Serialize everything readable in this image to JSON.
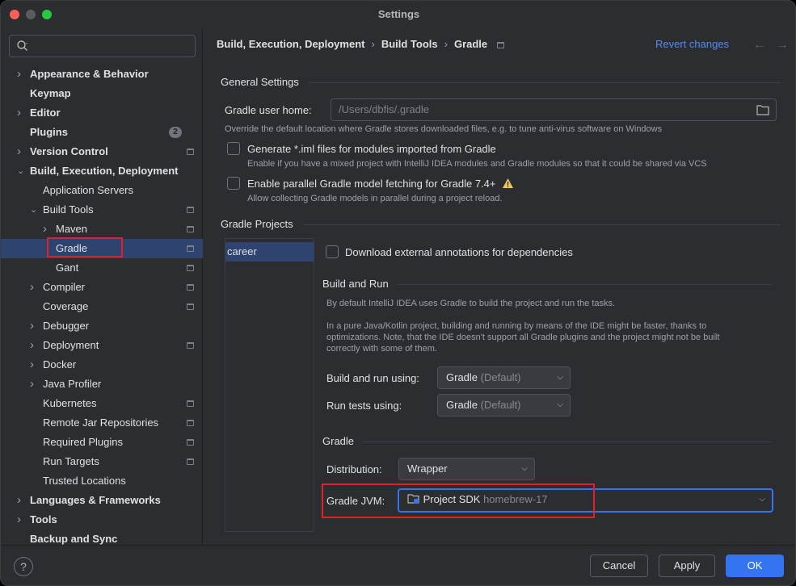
{
  "window": {
    "title": "Settings"
  },
  "search": {
    "placeholder": ""
  },
  "sidebar": {
    "items": [
      {
        "label": "Appearance & Behavior",
        "bold": true,
        "arrow": "right"
      },
      {
        "label": "Keymap",
        "bold": true
      },
      {
        "label": "Editor",
        "bold": true,
        "arrow": "right"
      },
      {
        "label": "Plugins",
        "bold": true,
        "badge": "2"
      },
      {
        "label": "Version Control",
        "bold": true,
        "arrow": "right",
        "project_icon": true
      },
      {
        "label": "Build, Execution, Deployment",
        "bold": true,
        "arrow": "down"
      },
      {
        "label": "Application Servers"
      },
      {
        "label": "Build Tools",
        "arrow": "down",
        "project_icon": true
      },
      {
        "label": "Maven",
        "arrow": "right",
        "project_icon": true
      },
      {
        "label": "Gradle",
        "selected": true,
        "project_icon": true
      },
      {
        "label": "Gant",
        "project_icon": true
      },
      {
        "label": "Compiler",
        "arrow": "right",
        "project_icon": true
      },
      {
        "label": "Coverage",
        "project_icon": true
      },
      {
        "label": "Debugger",
        "arrow": "right"
      },
      {
        "label": "Deployment",
        "arrow": "right",
        "project_icon": true
      },
      {
        "label": "Docker",
        "arrow": "right"
      },
      {
        "label": "Java Profiler",
        "arrow": "right"
      },
      {
        "label": "Kubernetes",
        "project_icon": true
      },
      {
        "label": "Remote Jar Repositories",
        "project_icon": true
      },
      {
        "label": "Required Plugins",
        "project_icon": true
      },
      {
        "label": "Run Targets",
        "project_icon": true
      },
      {
        "label": "Trusted Locations"
      },
      {
        "label": "Languages & Frameworks",
        "bold": true,
        "arrow": "right"
      },
      {
        "label": "Tools",
        "bold": true,
        "arrow": "right"
      },
      {
        "label": "Backup and Sync",
        "bold": true
      }
    ]
  },
  "breadcrumb": {
    "part1": "Build, Execution, Deployment",
    "part2": "Build Tools",
    "part3": "Gradle",
    "sep": "›"
  },
  "header": {
    "revert_label": "Revert changes",
    "back_arrow": "←",
    "forward_arrow": "→"
  },
  "general": {
    "title": "General Settings",
    "user_home_label": "Gradle user home:",
    "user_home_value": "/Users/dbfis/.gradle",
    "user_home_hint": "Override the default location where Gradle stores downloaded files, e.g. to tune anti-virus software on Windows",
    "iml_label": "Generate *.iml files for modules imported from Gradle",
    "iml_hint": "Enable if you have a mixed project with IntelliJ IDEA modules and Gradle modules so that it could be shared via VCS",
    "parallel_label": "Enable parallel Gradle model fetching for Gradle 7.4+",
    "parallel_hint": "Allow collecting Gradle models in parallel during a project reload."
  },
  "projects": {
    "title": "Gradle Projects",
    "list": [
      "career"
    ],
    "annotations_label": "Download external annotations for dependencies"
  },
  "build_run": {
    "title": "Build and Run",
    "desc1": "By default IntelliJ IDEA uses Gradle to build the project and run the tasks.",
    "desc2_l1": "In a pure Java/Kotlin project, building and running by means of the IDE might be faster, thanks to",
    "desc2_l2": "optimizations. Note, that the IDE doesn't support all Gradle plugins and the project might not be built",
    "desc2_l3": "correctly with some of them.",
    "build_label": "Build and run using:",
    "build_value": "Gradle",
    "build_suffix": "(Default)",
    "tests_label": "Run tests using:",
    "tests_value": "Gradle",
    "tests_suffix": "(Default)"
  },
  "gradle": {
    "title": "Gradle",
    "distribution_label": "Distribution:",
    "distribution_value": "Wrapper",
    "jvm_label": "Gradle JVM:",
    "jvm_value": "Project SDK",
    "jvm_suffix": "homebrew-17"
  },
  "footer": {
    "help": "?",
    "cancel": "Cancel",
    "apply": "Apply",
    "ok": "OK"
  },
  "colors": {
    "accent": "#3574f0",
    "link": "#548af7",
    "selection": "#2e436e",
    "highlight_box": "#e0202a",
    "warning": "#f2c55c"
  }
}
